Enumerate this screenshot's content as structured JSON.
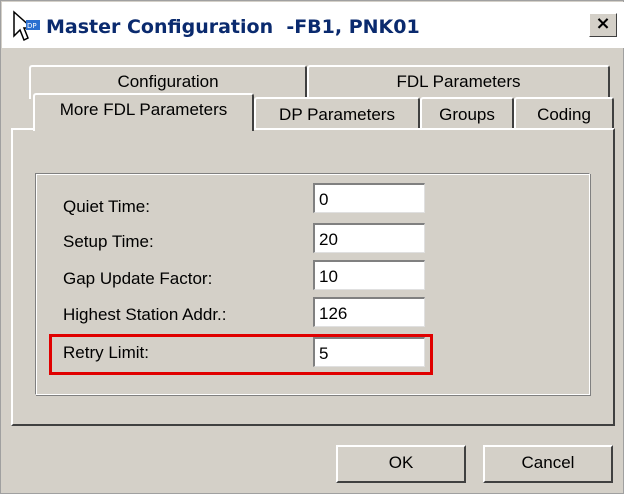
{
  "window": {
    "title": "Master Configuration  -FB1, PNK01",
    "close_glyph": "×",
    "app_icon": "pointer-cursor-app-icon"
  },
  "tabs": {
    "back_row": [
      {
        "label": "Configuration"
      },
      {
        "label": "FDL Parameters"
      }
    ],
    "front_row": [
      {
        "label": "More FDL Parameters",
        "selected": true
      },
      {
        "label": "DP Parameters"
      },
      {
        "label": "Groups"
      },
      {
        "label": "Coding"
      }
    ]
  },
  "fields": [
    {
      "label": "Quiet Time:",
      "value": "0"
    },
    {
      "label": "Setup Time:",
      "value": "20"
    },
    {
      "label": "Gap Update Factor:",
      "value": "10"
    },
    {
      "label": "Highest Station Addr.:",
      "value": "126"
    },
    {
      "label": "Retry Limit:",
      "value": "5"
    }
  ],
  "buttons": {
    "ok": "OK",
    "cancel": "Cancel"
  },
  "colors": {
    "highlight": "#e00000",
    "dialog_face": "#d4d0c8",
    "title_text": "#0a2a6e"
  }
}
